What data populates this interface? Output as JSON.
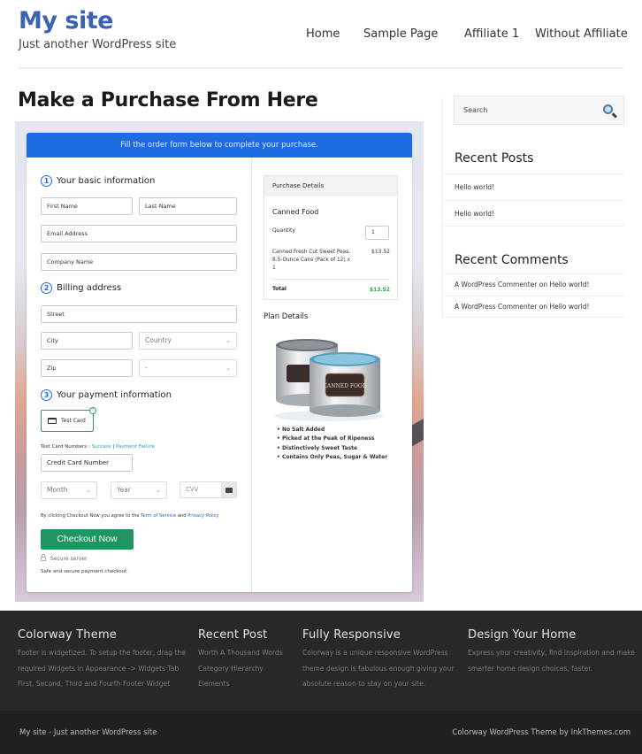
{
  "header": {
    "site_title": "My site",
    "tagline": "Just another WordPress site",
    "nav": [
      "Home",
      "Sample Page",
      "Affiliate 1",
      "Without Affiliate"
    ]
  },
  "page": {
    "title": "Make a Purchase From Here"
  },
  "form": {
    "banner": "Fill the order form below to complete your purchase.",
    "step1": {
      "num": "1",
      "title": "Your basic information"
    },
    "step2": {
      "num": "2",
      "title": "Billing address"
    },
    "step3": {
      "num": "3",
      "title": "Your payment information"
    },
    "fields": {
      "first_name": "First Name",
      "last_name": "Last Name",
      "email": "Email Address",
      "company": "Company Name",
      "street": "Street",
      "city": "City",
      "country": "Country",
      "zip": "Zip",
      "state": "-",
      "card_number": "Credit Card Number",
      "month": "Month",
      "year": "Year",
      "cvv": "CVV"
    },
    "payment_method": "Test Card",
    "test_card_label": "Test Card Numbers :",
    "test_success": "Success",
    "test_separator": "|",
    "test_failure": "Payment Failure",
    "agree_prefix": "By clicking Checkout Now you agree to the",
    "terms": "Term of Service",
    "and": "and",
    "privacy": "Privacy Policy",
    "checkout_button": "Checkout Now",
    "secure_server": "Secure server",
    "safe_text": "Safe and secure payment checkout."
  },
  "purchase": {
    "header": "Purchase Details",
    "product": "Canned Food",
    "quantity_label": "Quantity",
    "quantity": "1",
    "item_desc": "Canned Fresh Cut Sweet Peas, 8.5-Ounce Cans (Pack of 12) x 1",
    "item_price": "$13.52",
    "total_label": "Total",
    "total": "$13.52",
    "plan_title": "Plan Details",
    "features": [
      "No Salt Added",
      "Picked at the Peak of Ripeness",
      "Distinctively Sweet Taste",
      "Contains Only Peas, Sugar & Water"
    ],
    "can_label": "CANNED FOOD"
  },
  "sidebar": {
    "search_placeholder": "Search",
    "recent_posts_title": "Recent Posts",
    "recent_posts": [
      "Hello world!",
      "Hello world!"
    ],
    "recent_comments_title": "Recent Comments",
    "recent_comments": [
      "A WordPress Commenter on Hello world!",
      "A WordPress Commenter on Hello world!"
    ]
  },
  "footer": {
    "col1": {
      "title": "Colorway Theme",
      "lines": [
        "Footer is widgetized. To setup the footer, drag the",
        "required Widgets in Appearance -> Widgets Tab",
        "First, Second, Third and Fourth Footer Widget"
      ]
    },
    "col2": {
      "title": "Recent Post",
      "links": [
        "Worth A Thousand Words",
        "Category Hierarchy",
        "Elements"
      ]
    },
    "col3": {
      "title": "Fully Responsive",
      "lines": [
        "Colorway is a unique responsive WordPress",
        "theme design is fabulous enough giving your",
        "absolute reason to stay on your site."
      ]
    },
    "col4": {
      "title": "Design Your Home",
      "lines": [
        "Express your creativity, find inspiration and make",
        "smarter home design choices, faster."
      ]
    },
    "bottom_left": "My site - Just another WordPress site",
    "bottom_right": "Colorway WordPress Theme by InkThemes.com"
  },
  "colors": {
    "brand_blue": "#3a62b5",
    "banner_blue": "#1c6be0",
    "checkout_green": "#1f9561",
    "total_green": "#2aa24c",
    "footer_bg": "#282828"
  }
}
